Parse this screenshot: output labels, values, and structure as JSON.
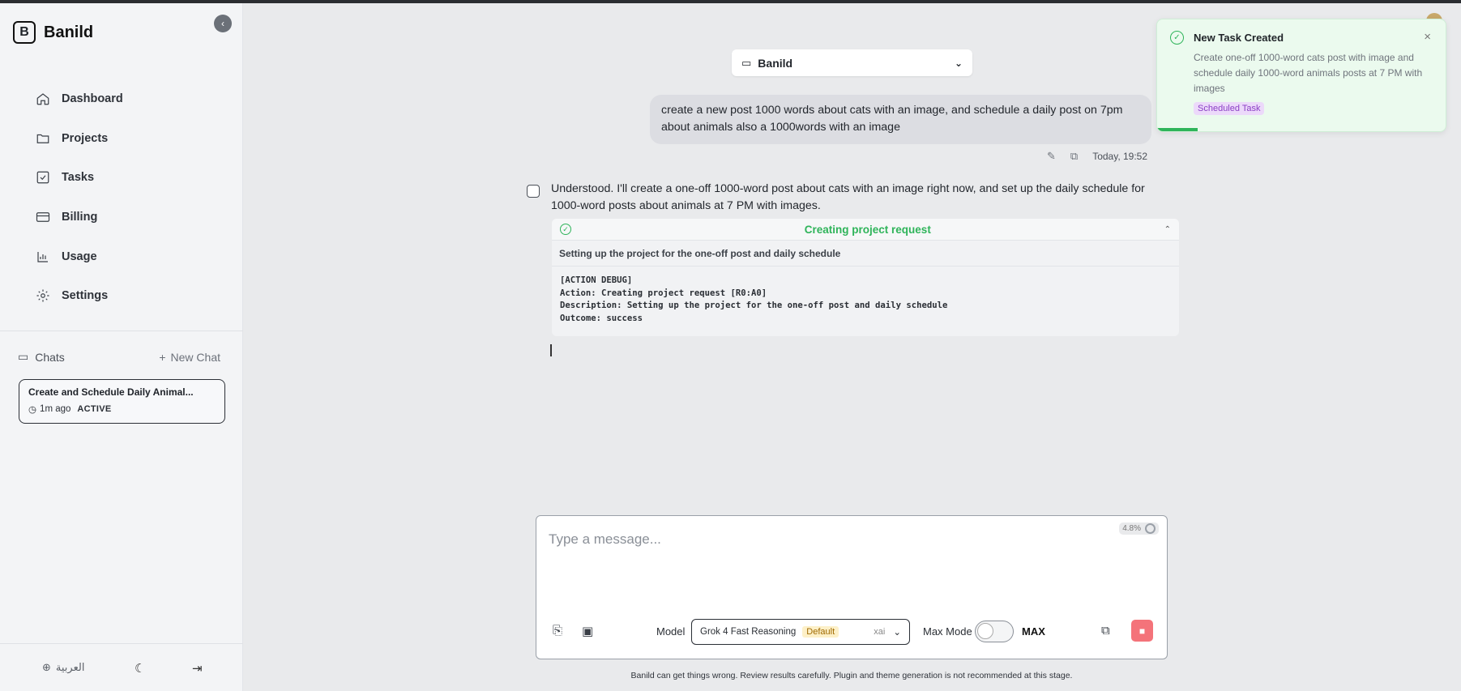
{
  "brand": {
    "name": "Banild"
  },
  "sidebar": {
    "nav": [
      {
        "label": "Dashboard",
        "icon": "home-icon"
      },
      {
        "label": "Projects",
        "icon": "folder-icon"
      },
      {
        "label": "Tasks",
        "icon": "checkbox-icon"
      },
      {
        "label": "Billing",
        "icon": "card-icon"
      },
      {
        "label": "Usage",
        "icon": "chart-icon"
      },
      {
        "label": "Settings",
        "icon": "gear-icon"
      }
    ],
    "chats_label": "Chats",
    "new_chat_label": "New Chat",
    "chats": [
      {
        "title": "Create and Schedule Daily Animal...",
        "time": "1m ago",
        "status": "ACTIVE"
      }
    ],
    "language_label": "العربية"
  },
  "project_select": {
    "value": "Banild"
  },
  "conversation": {
    "user_message": "create a new post 1000 words about cats with an image, and schedule a daily post on 7pm about animals also a 1000words with an image",
    "user_timestamp": "Today, 19:52",
    "assistant_message": "Understood. I'll create a one-off 1000-word post about cats with an image right now, and set up the daily schedule for 1000-word posts about animals at 7 PM with images.",
    "action": {
      "title": "Creating project request",
      "description": "Setting up the project for the one-off post and daily schedule",
      "debug": "[ACTION DEBUG]\nAction: Creating project request [R0:A0]\nDescription: Setting up the project for the one-off post and daily schedule\nOutcome: success"
    }
  },
  "composer": {
    "placeholder": "Type a message...",
    "context_usage": "4.8%",
    "model_label": "Model",
    "model_value": "Grok 4 Fast Reasoning",
    "model_badge": "Default",
    "model_provider": "xai",
    "max_mode_label": "Max Mode",
    "max_label": "MAX",
    "max_mode_on": false
  },
  "disclaimer": "Banild can get things wrong. Review results carefully. Plugin and theme generation is not recommended at this stage.",
  "toast": {
    "title": "New Task Created",
    "body": "Create one-off 1000-word cats post with image and schedule daily 1000-word animals posts at 7 PM with images",
    "tag": "Scheduled Task"
  },
  "colors": {
    "success": "#2fb45a",
    "stop": "#f4737a",
    "tag_bg": "#ecd9fa",
    "badge_bg": "#fdf0c8"
  }
}
